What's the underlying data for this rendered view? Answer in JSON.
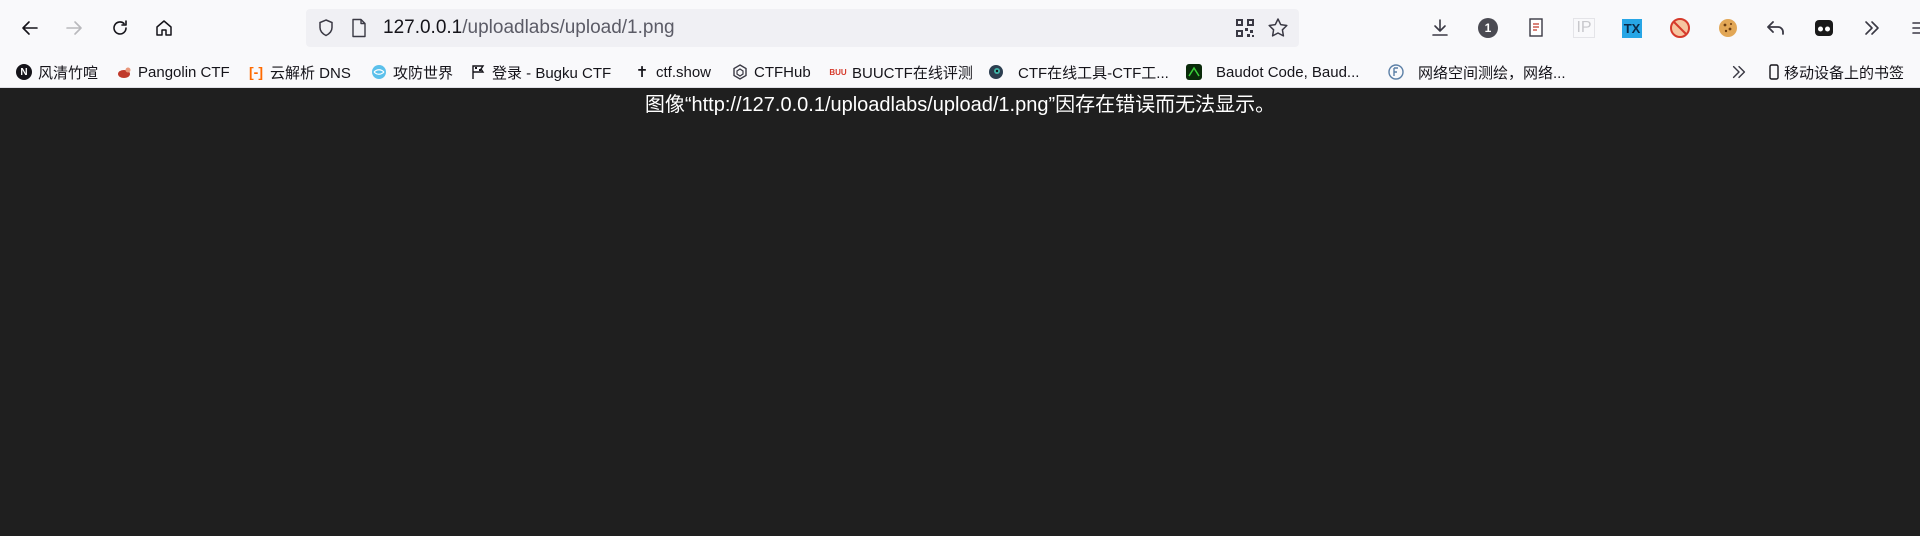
{
  "toolbar": {
    "url_host": "127.0.0.1",
    "url_path": "/uploadlabs/upload/1.png"
  },
  "tools": {
    "extension_badge": "1",
    "ip_label": "IP",
    "tx_label": "TX"
  },
  "bookmarks": [
    {
      "label": "风清竹喧",
      "icon": "n-logo-icon"
    },
    {
      "label": "Pangolin CTF",
      "icon": "pangolin-icon"
    },
    {
      "label": "云解析 DNS",
      "icon": "aliyun-icon"
    },
    {
      "label": "攻防世界",
      "icon": "globe-icon"
    },
    {
      "label": "登录 - Bugku CTF",
      "icon": "flag-icon"
    },
    {
      "label": "ctf.show",
      "icon": "ctfshow-icon"
    },
    {
      "label": "CTFHub",
      "icon": "ctfhub-icon"
    },
    {
      "label": "BUUCTF在线评测",
      "icon": "buuctf-icon"
    },
    {
      "label": "CTF在线工具-CTF工...",
      "icon": "eye-icon"
    },
    {
      "label": "Baudot Code, Baud...",
      "icon": "matrix-icon"
    },
    {
      "label": "网络空间测绘，网络...",
      "icon": "fofa-icon"
    }
  ],
  "mobile_bookmarks": "移动设备上的书签",
  "page": {
    "error_message": "图像“http://127.0.0.1/uploadlabs/upload/1.png”因存在错误而无法显示。"
  },
  "colors": {
    "page_bg": "#1f1f1f",
    "toolbar_bg": "#f9f9fb",
    "urlbar_bg": "#f0f0f4"
  }
}
